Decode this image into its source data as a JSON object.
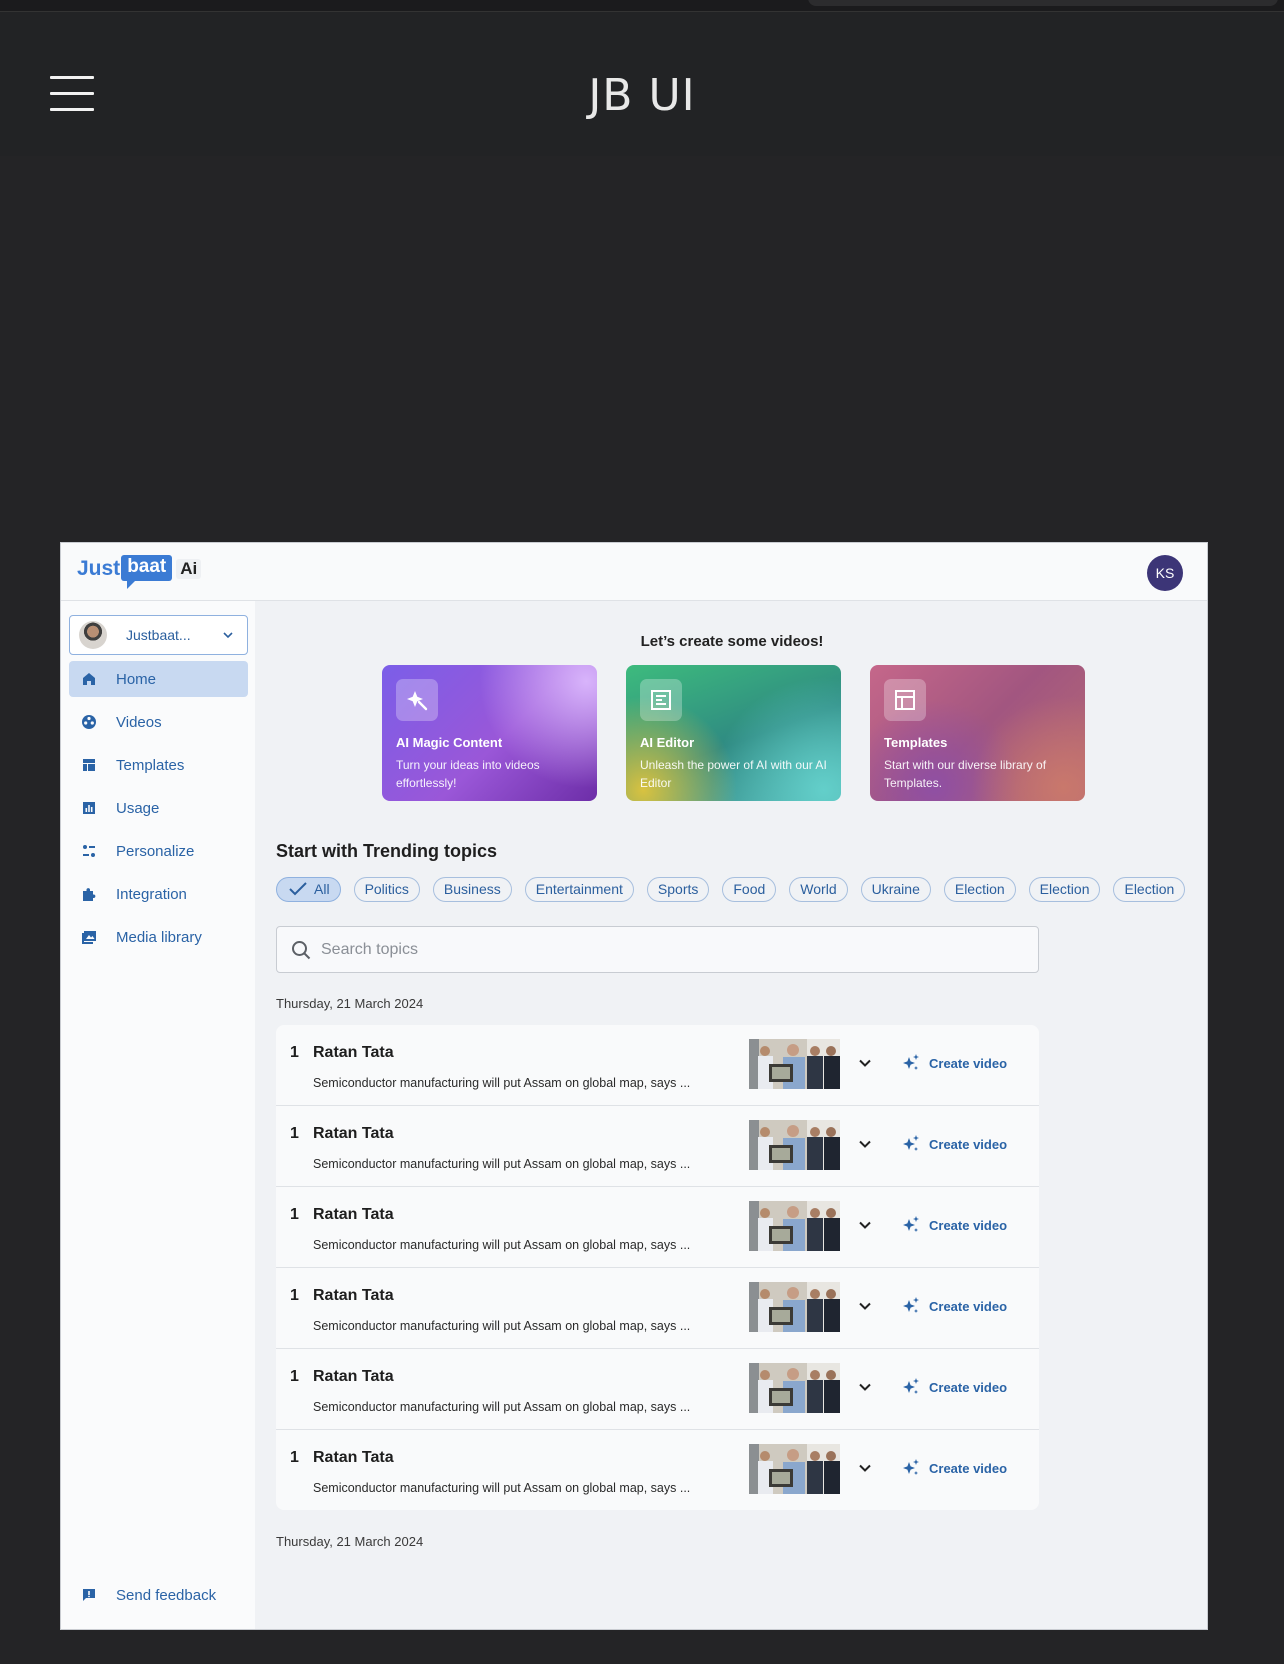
{
  "app": {
    "title": "JB UI"
  },
  "brand": {
    "part1": "Just",
    "part2": "baat",
    "part3": "Ai"
  },
  "user": {
    "initials": "KS"
  },
  "workspace": {
    "name": "Justbaat..."
  },
  "nav": [
    {
      "label": "Home",
      "icon": "home-icon",
      "active": true
    },
    {
      "label": "Videos",
      "icon": "video-reel-icon"
    },
    {
      "label": "Templates",
      "icon": "template-icon"
    },
    {
      "label": "Usage",
      "icon": "bar-chart-icon"
    },
    {
      "label": "Personalize",
      "icon": "sliders-icon"
    },
    {
      "label": "Integration",
      "icon": "puzzle-icon"
    },
    {
      "label": "Media library",
      "icon": "media-library-icon"
    }
  ],
  "feedback": {
    "label": "Send feedback",
    "icon": "feedback-icon"
  },
  "hero": {
    "title": "Let’s create some videos!",
    "cards": [
      {
        "title": "AI Magic Content",
        "desc": "Turn your ideas into videos effortlessly!",
        "icon": "magic-icon"
      },
      {
        "title": "AI Editor",
        "desc": "Unleash the power of AI with our AI Editor",
        "icon": "editor-icon"
      },
      {
        "title": "Templates",
        "desc": "Start with our diverse library of Templates.",
        "icon": "layout-icon"
      }
    ]
  },
  "trending": {
    "title": "Start with Trending topics",
    "chips": [
      "All",
      "Politics",
      "Business",
      "Entertainment",
      "Sports",
      "Food",
      "World",
      "Ukraine",
      "Election",
      "Election",
      "Election"
    ],
    "search_placeholder": "Search topics"
  },
  "dates": [
    "Thursday, 21 March 2024",
    "Thursday, 21 March 2024"
  ],
  "topics": [
    {
      "rank": "1",
      "title": "Ratan Tata",
      "snippet": "Semiconductor manufacturing will put Assam on global map, says ...",
      "action": "Create video"
    },
    {
      "rank": "1",
      "title": "Ratan Tata",
      "snippet": "Semiconductor manufacturing will put Assam on global map, says ...",
      "action": "Create video"
    },
    {
      "rank": "1",
      "title": "Ratan Tata",
      "snippet": "Semiconductor manufacturing will put Assam on global map, says ...",
      "action": "Create video"
    },
    {
      "rank": "1",
      "title": "Ratan Tata",
      "snippet": "Semiconductor manufacturing will put Assam on global map, says ...",
      "action": "Create video"
    },
    {
      "rank": "1",
      "title": "Ratan Tata",
      "snippet": "Semiconductor manufacturing will put Assam on global map, says ...",
      "action": "Create video"
    },
    {
      "rank": "1",
      "title": "Ratan Tata",
      "snippet": "Semiconductor manufacturing will put Assam on global map, says ...",
      "action": "Create video"
    }
  ],
  "colors": {
    "accent": "#2a63a6",
    "active_bg": "#c8d9f1",
    "brand_blue": "#3b7bd4",
    "avatar_bg": "#3c3577"
  }
}
